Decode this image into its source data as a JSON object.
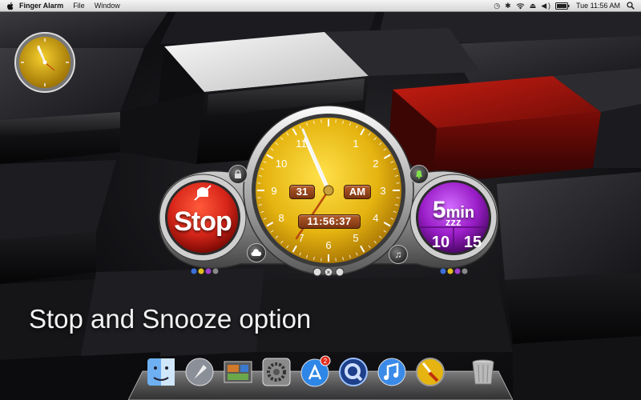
{
  "menubar": {
    "app_name": "Finger Alarm",
    "menus": [
      "File",
      "Window"
    ],
    "clock": "Tue 11:56 AM",
    "status_icons": [
      "time-machine-icon",
      "bluetooth-icon",
      "wifi-icon",
      "eject-icon",
      "volume-icon",
      "battery-icon",
      "spotlight-icon"
    ]
  },
  "alarm": {
    "stop_label": "Stop",
    "date": "31",
    "ampm": "AM",
    "time": "11:56:37",
    "snooze_value": "5",
    "snooze_unit": "min",
    "snooze_z": "zzz",
    "snooze_left": "10",
    "snooze_right": "15",
    "clock_numbers": [
      "1",
      "2",
      "3",
      "4",
      "5",
      "6",
      "7",
      "8",
      "9",
      "10",
      "11"
    ]
  },
  "caption": "Stop and Snooze option",
  "dock": {
    "icons": [
      "finder-icon",
      "launchpad-icon",
      "photos-icon",
      "system-preferences-icon",
      "app-store-icon",
      "quicktime-icon",
      "itunes-icon",
      "finger-alarm-icon",
      "trash-icon"
    ],
    "app_store_badge": "2"
  },
  "colors": {
    "stop_red": "#d8261a",
    "snooze_purple": "#9a1ec8",
    "clock_gold": "#e5b410",
    "tag_brown": "#9a4a1e",
    "cube_red": "#b0150f"
  }
}
